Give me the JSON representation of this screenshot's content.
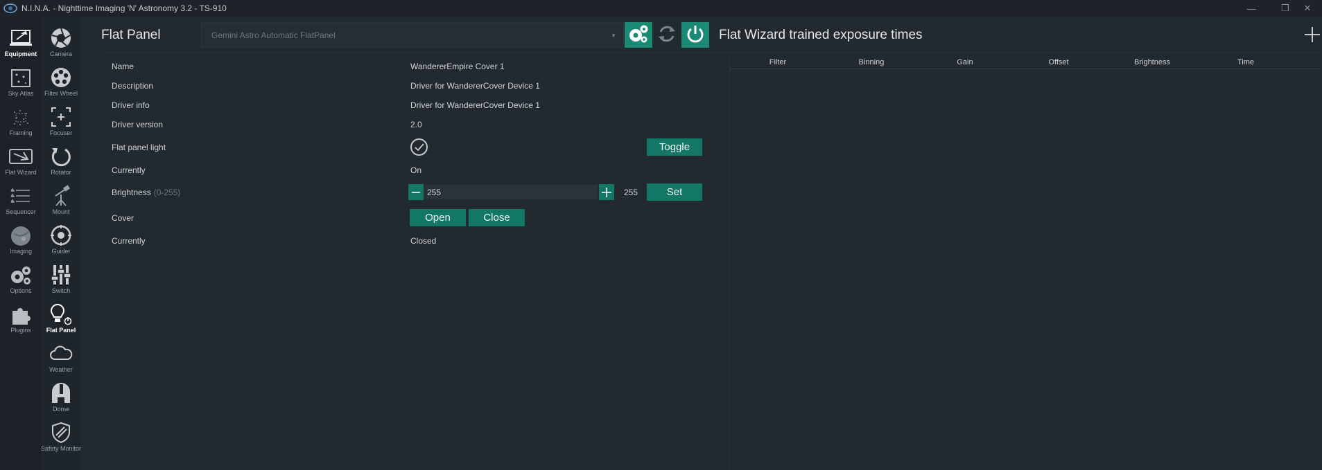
{
  "window": {
    "title": "N.I.N.A. - Nighttime Imaging 'N' Astronomy 3.2   -  TS-910",
    "minimize": "—",
    "maximize": "❐",
    "close": "✕"
  },
  "main_nav": [
    {
      "label": "Equipment",
      "icon": "telescope-laptop-icon",
      "active": true
    },
    {
      "label": "Sky Atlas",
      "icon": "sky-atlas-icon",
      "active": false
    },
    {
      "label": "Framing",
      "icon": "framing-icon",
      "active": false
    },
    {
      "label": "Flat Wizard",
      "icon": "flat-wizard-icon",
      "active": false
    },
    {
      "label": "Sequencer",
      "icon": "sequencer-icon",
      "active": false
    },
    {
      "label": "Imaging",
      "icon": "imaging-icon",
      "active": false
    },
    {
      "label": "Options",
      "icon": "gears-icon",
      "active": false
    },
    {
      "label": "Plugins",
      "icon": "puzzle-icon",
      "active": false
    }
  ],
  "equipment_nav": [
    {
      "label": "Camera",
      "icon": "camera-aperture-icon",
      "active": false
    },
    {
      "label": "Filter Wheel",
      "icon": "filter-wheel-icon",
      "active": false
    },
    {
      "label": "Focuser",
      "icon": "focuser-icon",
      "active": false
    },
    {
      "label": "Rotator",
      "icon": "rotator-icon",
      "active": false
    },
    {
      "label": "Mount",
      "icon": "mount-icon",
      "active": false
    },
    {
      "label": "Guider",
      "icon": "guider-icon",
      "active": false
    },
    {
      "label": "Switch",
      "icon": "switch-icon",
      "active": false
    },
    {
      "label": "Flat Panel",
      "icon": "flat-panel-bulb-icon",
      "active": true
    },
    {
      "label": "Weather",
      "icon": "weather-cloud-icon",
      "active": false
    },
    {
      "label": "Dome",
      "icon": "dome-icon",
      "active": false
    },
    {
      "label": "Safety Monitor",
      "icon": "safety-shield-icon",
      "active": false
    }
  ],
  "panel": {
    "title": "Flat Panel",
    "device": "Gemini Astro Automatic FlatPanel",
    "settings_icon": "gears-icon",
    "refresh_icon": "refresh-icon",
    "power_icon": "power-icon"
  },
  "properties": {
    "name_label": "Name",
    "name_value": "WandererEmpire Cover 1",
    "description_label": "Description",
    "description_value": "Driver for WandererCover Device 1",
    "driver_info_label": "Driver info",
    "driver_info_value": "Driver for WandererCover Device 1",
    "driver_version_label": "Driver version",
    "driver_version_value": "2.0",
    "light_label": "Flat panel light",
    "light_on": true,
    "toggle_label": "Toggle",
    "light_state_label": "Currently",
    "light_state_value": "On",
    "brightness_label": "Brightness",
    "brightness_hint": "(0-255)",
    "brightness_input": "255",
    "brightness_current": "255",
    "set_label": "Set",
    "cover_label": "Cover",
    "open_label": "Open",
    "close_label": "Close",
    "cover_state_label": "Currently",
    "cover_state_value": "Closed"
  },
  "flat_wizard": {
    "title": "Flat Wizard trained exposure times",
    "columns": [
      "Filter",
      "Binning",
      "Gain",
      "Offset",
      "Brightness",
      "Time"
    ],
    "rows": []
  },
  "colors": {
    "accent": "#137765",
    "accent_bright": "#1a8a75",
    "background": "#222a30",
    "nav_bg": "#1c2227"
  }
}
